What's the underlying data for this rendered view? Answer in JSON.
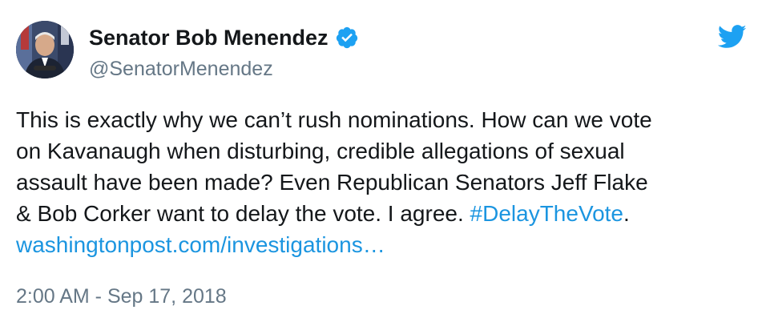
{
  "author": {
    "display_name": "Senator Bob Menendez",
    "handle": "@SenatorMenendez",
    "verified": true
  },
  "tweet": {
    "line1": "This is exactly why we can’t rush nominations. How can we vote",
    "line2": "on Kavanaugh when disturbing, credible allegations of sexual",
    "line3": "assault have been made? Even Republican Senators Jeff Flake",
    "line4_text": "& Bob Corker want to delay the vote. I agree. ",
    "hashtag": "#DelayTheVote",
    "line4_end": ".",
    "link": "washingtonpost.com/investigations…"
  },
  "timestamp": "2:00 AM - Sep 17, 2018",
  "colors": {
    "link": "#1b95e0",
    "muted": "#657786",
    "text": "#14171a",
    "twitter_blue": "#1da1f2"
  },
  "icons": {
    "verified": "verified-badge-icon",
    "brand": "twitter-bird-icon"
  }
}
